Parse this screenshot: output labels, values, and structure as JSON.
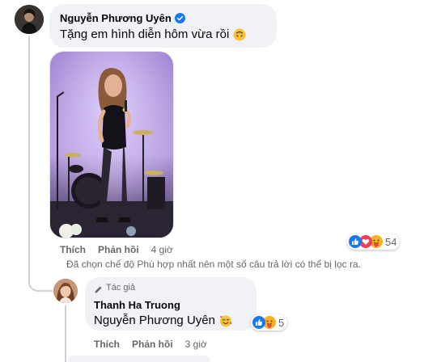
{
  "comment": {
    "author": "Nguyễn Phương Uyên",
    "text": "Tặng em hình diễn hôm vừa rồi",
    "actions": {
      "like": "Thích",
      "reply": "Phản hồi",
      "time": "4 giờ"
    },
    "reactions": {
      "count": "54",
      "icons": [
        "like-icon",
        "love-icon",
        "care-icon"
      ]
    },
    "filter_note": "Đã chọn chế độ Phù hợp nhất nên một số câu trả lời có thể bị lọc ra."
  },
  "reply": {
    "badge": "Tác giả",
    "author": "Thanh Ha Truong",
    "text": "Nguyễn Phương Uyên",
    "actions": {
      "like": "Thích",
      "reply": "Phản hồi",
      "time": "3 giờ"
    },
    "reactions": {
      "count": "5",
      "icons": [
        "like-icon",
        "care-icon"
      ]
    }
  },
  "colors": {
    "verified": "#1877f2",
    "like": "#1877f2",
    "love": "#f33e58",
    "care": "#f7b125",
    "secondary_text": "#65676b",
    "bubble": "#f0f2f5"
  }
}
